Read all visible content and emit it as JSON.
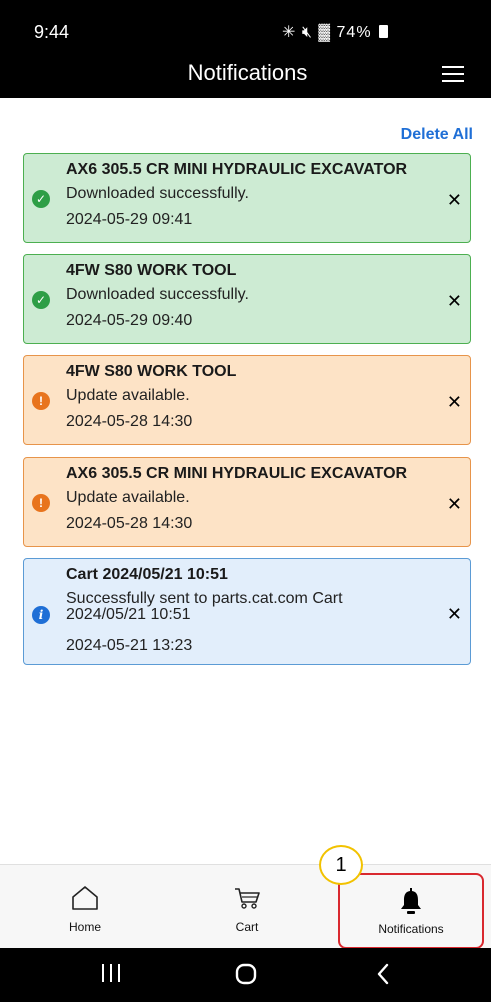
{
  "status_bar": {
    "time": "9:44",
    "icons": "✳ ✕ ≡ .∥",
    "battery": "74%"
  },
  "header": {
    "title": "Notifications",
    "menu_icon": "hamburger-menu-icon"
  },
  "actions": {
    "delete_all": "Delete All"
  },
  "notifications": [
    {
      "status": "success",
      "icon": "check-circle-icon",
      "title": "AX6 305.5 CR MINI HYDRAULIC EXCAVATOR",
      "message": "Downloaded successfully.",
      "date": "2024-05-29 09:41"
    },
    {
      "status": "success",
      "icon": "check-circle-icon",
      "title": "4FW S80 WORK TOOL",
      "message": "Downloaded successfully.",
      "date": "2024-05-29 09:40"
    },
    {
      "status": "warning",
      "icon": "alert-circle-icon",
      "title": "4FW S80 WORK TOOL",
      "message": "Update available.",
      "date": "2024-05-28 14:30"
    },
    {
      "status": "warning",
      "icon": "alert-circle-icon",
      "title": "AX6 305.5 CR MINI HYDRAULIC EXCAVATOR",
      "message": "Update available.",
      "date": "2024-05-28 14:30"
    },
    {
      "status": "info",
      "icon": "info-circle-icon",
      "title": "Cart 2024/05/21 10:51",
      "message": "Successfully sent to parts.cat.com Cart 2024/05/21 10:51",
      "date": "2024-05-21 13:23"
    }
  ],
  "bottom_nav": {
    "home": "Home",
    "cart": "Cart",
    "notifications": "Notifications"
  },
  "callout": "1",
  "colors": {
    "link": "#1f6fd6",
    "success_bg": "#cdebd3",
    "warning_bg": "#fde3c6",
    "info_bg": "#e2eefb",
    "highlight": "#d9292f",
    "callout_border": "#f2c200"
  }
}
